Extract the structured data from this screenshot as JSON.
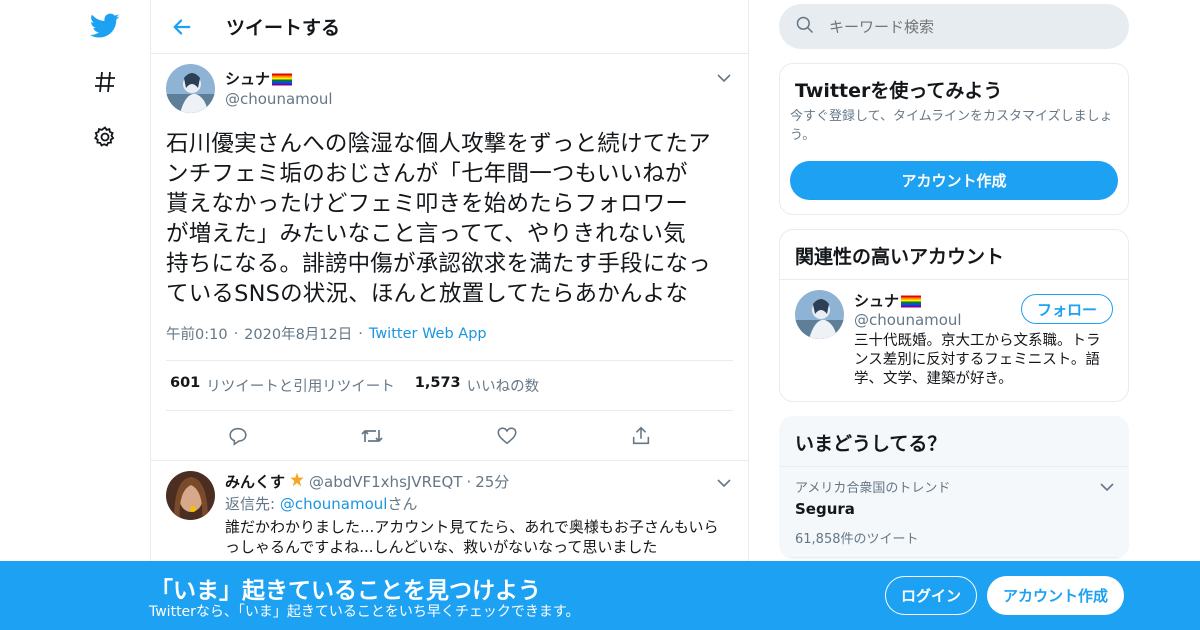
{
  "colors": {
    "brand": "#1da1f2",
    "link": "#1b95e0",
    "muted": "#657786",
    "text": "#14171a",
    "border": "#e6ecf0"
  },
  "nav": {
    "icons": [
      "twitter-bird-icon",
      "hashtag-icon",
      "gear-icon"
    ]
  },
  "header": {
    "title": "ツイートする"
  },
  "tweet": {
    "author_name": "シュナ",
    "author_handle": "@chounamoul",
    "text": "石川優実さんへの陰湿な個人攻撃をずっと続けてたア\nンチフェミ垢のおじさんが「七年間一つもいいねが\n貰えなかったけどフェミ叩きを始めたらフォロワー\nが増えた」みたいなこと言ってて、やりきれない気\n持ちになる。誹謗中傷が承認欲求を満たす手段になっ\nているSNSの状況、ほんと放置してたらあかんよな",
    "time": "午前0:10",
    "date": "2020年8月12日",
    "source": "Twitter Web App",
    "retweet_count": "601",
    "retweet_label": "リツイートと引用リツイート",
    "like_count": "1,573",
    "like_label": "いいねの数"
  },
  "reply": {
    "name": "みんくす",
    "handle": "@abdVF1xhsJVREQT",
    "time": "25分",
    "reply_to_prefix": "返信先: ",
    "reply_to_handle": "@chounamoul",
    "reply_to_suffix": "さん",
    "text": "誰だかわかりました...アカウント見てたら、あれで奥様もお子さんもいらっしゃるんですよね...しんどいな、救いがないなって思いました"
  },
  "search": {
    "placeholder": "キーワード検索"
  },
  "signup_card": {
    "title": "Twitterを使ってみよう",
    "desc": "今すぐ登録して、タイムラインをカスタマイズしましょう。",
    "button": "アカウント作成"
  },
  "related": {
    "title": "関連性の高いアカウント",
    "name": "シュナ",
    "handle": "@chounamoul",
    "follow": "フォロー",
    "bio": "三十代既婚。京大工から文系職。トランス差別に反対するフェミニスト。語学、文学、建築が好き。"
  },
  "trends": {
    "title": "いまどうしてる？",
    "items": [
      {
        "context": "アメリカ合衆国のトレンド",
        "name": "Segura",
        "count": "61,858件のツイート"
      }
    ]
  },
  "bottom_bar": {
    "title": "「いま」起きていることを見つけよう",
    "subtitle": "Twitterなら、「いま」起きていることをいち早くチェックできます。",
    "login": "ログイン",
    "signup": "アカウント作成"
  }
}
